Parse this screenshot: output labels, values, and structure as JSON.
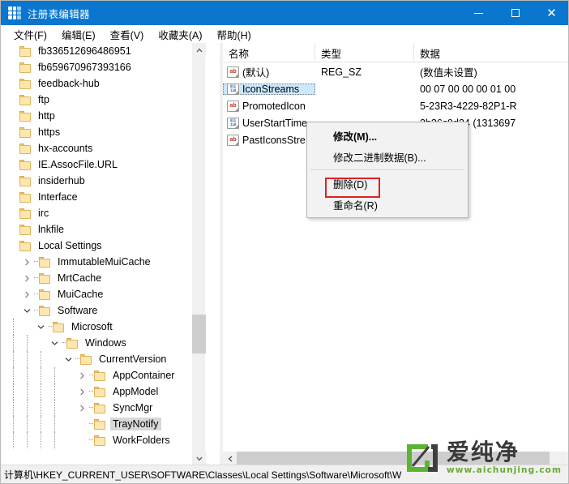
{
  "window": {
    "title": "注册表编辑器",
    "icon": "registry-blocks-icon",
    "titlebar_color": "#0b76ce",
    "controls": {
      "minimize": "minimize-icon",
      "maximize": "maximize-icon",
      "close": "close-icon"
    }
  },
  "menubar": {
    "items": [
      {
        "label": "文件(F)"
      },
      {
        "label": "编辑(E)"
      },
      {
        "label": "查看(V)"
      },
      {
        "label": "收藏夹(A)"
      },
      {
        "label": "帮助(H)"
      }
    ]
  },
  "tree": {
    "nodes": [
      {
        "label": "fb336512696486951",
        "indent": 0,
        "twisty": "none",
        "selected": false
      },
      {
        "label": "fb659670967393166",
        "indent": 0,
        "twisty": "none",
        "selected": false
      },
      {
        "label": "feedback-hub",
        "indent": 0,
        "twisty": "none",
        "selected": false
      },
      {
        "label": "ftp",
        "indent": 0,
        "twisty": "none",
        "selected": false
      },
      {
        "label": "http",
        "indent": 0,
        "twisty": "none",
        "selected": false
      },
      {
        "label": "https",
        "indent": 0,
        "twisty": "none",
        "selected": false
      },
      {
        "label": "hx-accounts",
        "indent": 0,
        "twisty": "none",
        "selected": false
      },
      {
        "label": "IE.AssocFile.URL",
        "indent": 0,
        "twisty": "none",
        "selected": false
      },
      {
        "label": "insiderhub",
        "indent": 0,
        "twisty": "none",
        "selected": false
      },
      {
        "label": "Interface",
        "indent": 0,
        "twisty": "none",
        "selected": false
      },
      {
        "label": "irc",
        "indent": 0,
        "twisty": "none",
        "selected": false
      },
      {
        "label": "lnkfile",
        "indent": 0,
        "twisty": "none",
        "selected": false
      },
      {
        "label": "Local Settings",
        "indent": 0,
        "twisty": "none",
        "selected": false
      },
      {
        "label": "ImmutableMuiCache",
        "indent": 1,
        "twisty": "collapsed",
        "selected": false
      },
      {
        "label": "MrtCache",
        "indent": 1,
        "twisty": "collapsed",
        "selected": false
      },
      {
        "label": "MuiCache",
        "indent": 1,
        "twisty": "collapsed",
        "selected": false
      },
      {
        "label": "Software",
        "indent": 1,
        "twisty": "expanded",
        "selected": false
      },
      {
        "label": "Microsoft",
        "indent": 2,
        "twisty": "expanded",
        "selected": false
      },
      {
        "label": "Windows",
        "indent": 3,
        "twisty": "expanded",
        "selected": false
      },
      {
        "label": "CurrentVersion",
        "indent": 4,
        "twisty": "expanded",
        "selected": false
      },
      {
        "label": "AppContainer",
        "indent": 5,
        "twisty": "collapsed",
        "selected": false
      },
      {
        "label": "AppModel",
        "indent": 5,
        "twisty": "collapsed",
        "selected": false
      },
      {
        "label": "SyncMgr",
        "indent": 5,
        "twisty": "collapsed",
        "selected": false
      },
      {
        "label": "TrayNotify",
        "indent": 5,
        "twisty": "none",
        "selected": true
      },
      {
        "label": "WorkFolders",
        "indent": 5,
        "twisty": "none",
        "selected": false
      }
    ],
    "scrollbar": {
      "up_arrow": "chevron-up-icon",
      "down_arrow": "chevron-down-icon"
    }
  },
  "list": {
    "columns": [
      {
        "label": "名称"
      },
      {
        "label": "类型"
      },
      {
        "label": "数据"
      }
    ],
    "rows": [
      {
        "name": "(默认)",
        "type": "REG_SZ",
        "data": "(数值未设置)",
        "icon": "string-value-icon",
        "selected": false
      },
      {
        "name": "IconStreams",
        "type": "",
        "data": "00 07 00 00 00 01 00",
        "icon": "binary-value-icon",
        "selected": true
      },
      {
        "name": "PromotedIcon",
        "type": "",
        "data": "5-23R3-4229-82P1-R",
        "icon": "string-value-icon",
        "selected": false
      },
      {
        "name": "UserStartTime",
        "type": "",
        "data": "3b36c9d34 (1313697",
        "icon": "binary-value-icon",
        "selected": false
      },
      {
        "name": "PastIconsStre",
        "type": "",
        "data": "",
        "icon": "string-value-icon",
        "selected": false
      }
    ],
    "hscrollbar": {
      "left_arrow": "chevron-left-icon"
    }
  },
  "context_menu": {
    "items": [
      {
        "label": "修改(M)...",
        "bold": true,
        "type": "item"
      },
      {
        "label": "修改二进制数据(B)...",
        "bold": false,
        "type": "item"
      },
      {
        "label": "",
        "bold": false,
        "type": "separator"
      },
      {
        "label": "删除(D)",
        "bold": false,
        "type": "item",
        "highlight": "#e02020"
      },
      {
        "label": "重命名(R)",
        "bold": false,
        "type": "item"
      }
    ]
  },
  "statusbar": {
    "path": "计算机\\HKEY_CURRENT_USER\\SOFTWARE\\Classes\\Local Settings\\Software\\Microsoft\\W"
  },
  "watermark": {
    "brand": "爱纯净",
    "url": "www.aichunjing.com",
    "green": "#6aa832",
    "dark": "#3a3a3a"
  }
}
